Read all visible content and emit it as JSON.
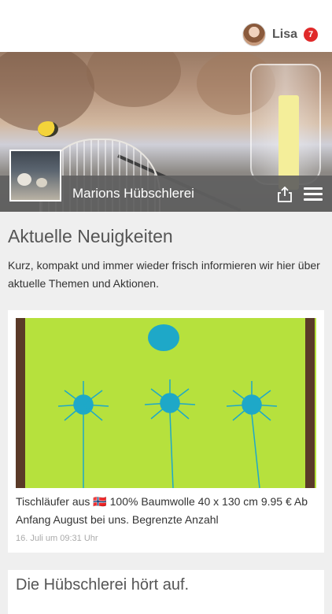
{
  "user": {
    "name": "Lisa",
    "notifications": "7"
  },
  "shop": {
    "name": "Marions Hübschlerei"
  },
  "section": {
    "title": "Aktuelle Neuigkeiten",
    "intro": "Kurz, kompakt und immer wieder frisch informieren wir hier über aktuelle Themen und Aktionen."
  },
  "posts": [
    {
      "text": "Tischläufer aus 🇳🇴 100% Baumwolle 40 x 130 cm 9.95 € Ab Anfang August bei uns. Begrenzte Anzahl",
      "time": "16. Juli um 09:31 Uhr"
    },
    {
      "title": "Die Hübschlerei hört auf."
    }
  ],
  "colors": {
    "accent_badge": "#e02a2a",
    "card_image_green": "#b6e13d",
    "flower_blue": "#1ea8c8"
  },
  "icons": [
    "share-icon",
    "menu-icon"
  ]
}
